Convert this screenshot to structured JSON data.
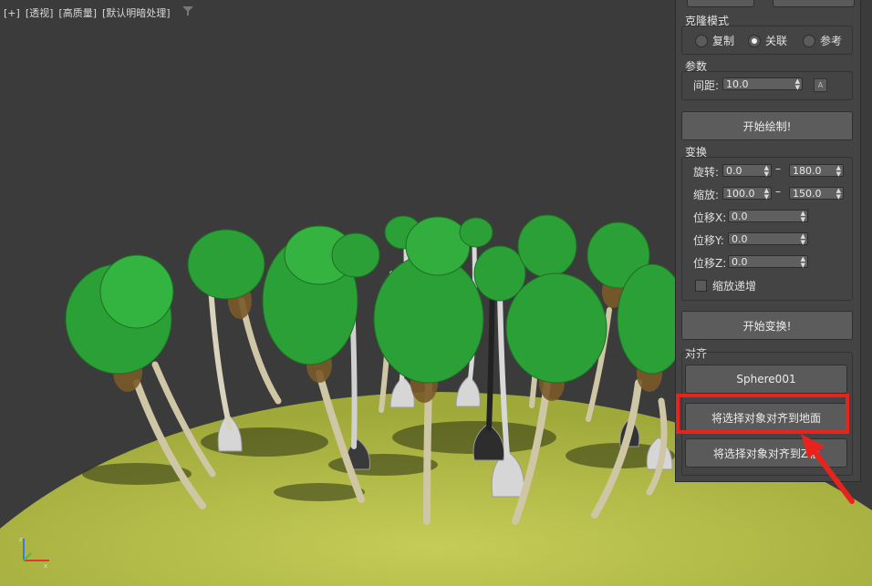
{
  "viewport": {
    "labels": [
      "[+]",
      "[透视]",
      "[高质量]",
      "[默认明暗处理]"
    ]
  },
  "panel": {
    "clone_mode": {
      "title": "克隆模式",
      "options": [
        "复制",
        "关联",
        "参考"
      ],
      "selected": "关联"
    },
    "params": {
      "title": "参数",
      "spacing_label": "间距:",
      "spacing_value": "10.0",
      "lock_label": "A"
    },
    "start_paint_label": "开始绘制!",
    "transform": {
      "title": "变换",
      "rotate_label": "旋转:",
      "rotate_min": "0.0",
      "rotate_max": "180.0",
      "scale_label": "缩放:",
      "scale_min": "100.0",
      "scale_max": "150.0",
      "offset_x_label": "位移X:",
      "offset_x_value": "0.0",
      "offset_y_label": "位移Y:",
      "offset_y_value": "0.0",
      "offset_z_label": "位移Z:",
      "offset_z_value": "0.0",
      "scale_increment_label": "缩放递增",
      "range_sep": "–"
    },
    "start_transform_label": "开始变换!",
    "align": {
      "title": "对齐",
      "object_name": "Sphere001",
      "align_ground_label": "将选择对象对齐到地面",
      "align_z_label": "将选择对象对齐到Z轴"
    }
  },
  "colors": {
    "highlight": "#e8231e",
    "ground": "#b9c24a",
    "foliage": "#2fa43a"
  }
}
